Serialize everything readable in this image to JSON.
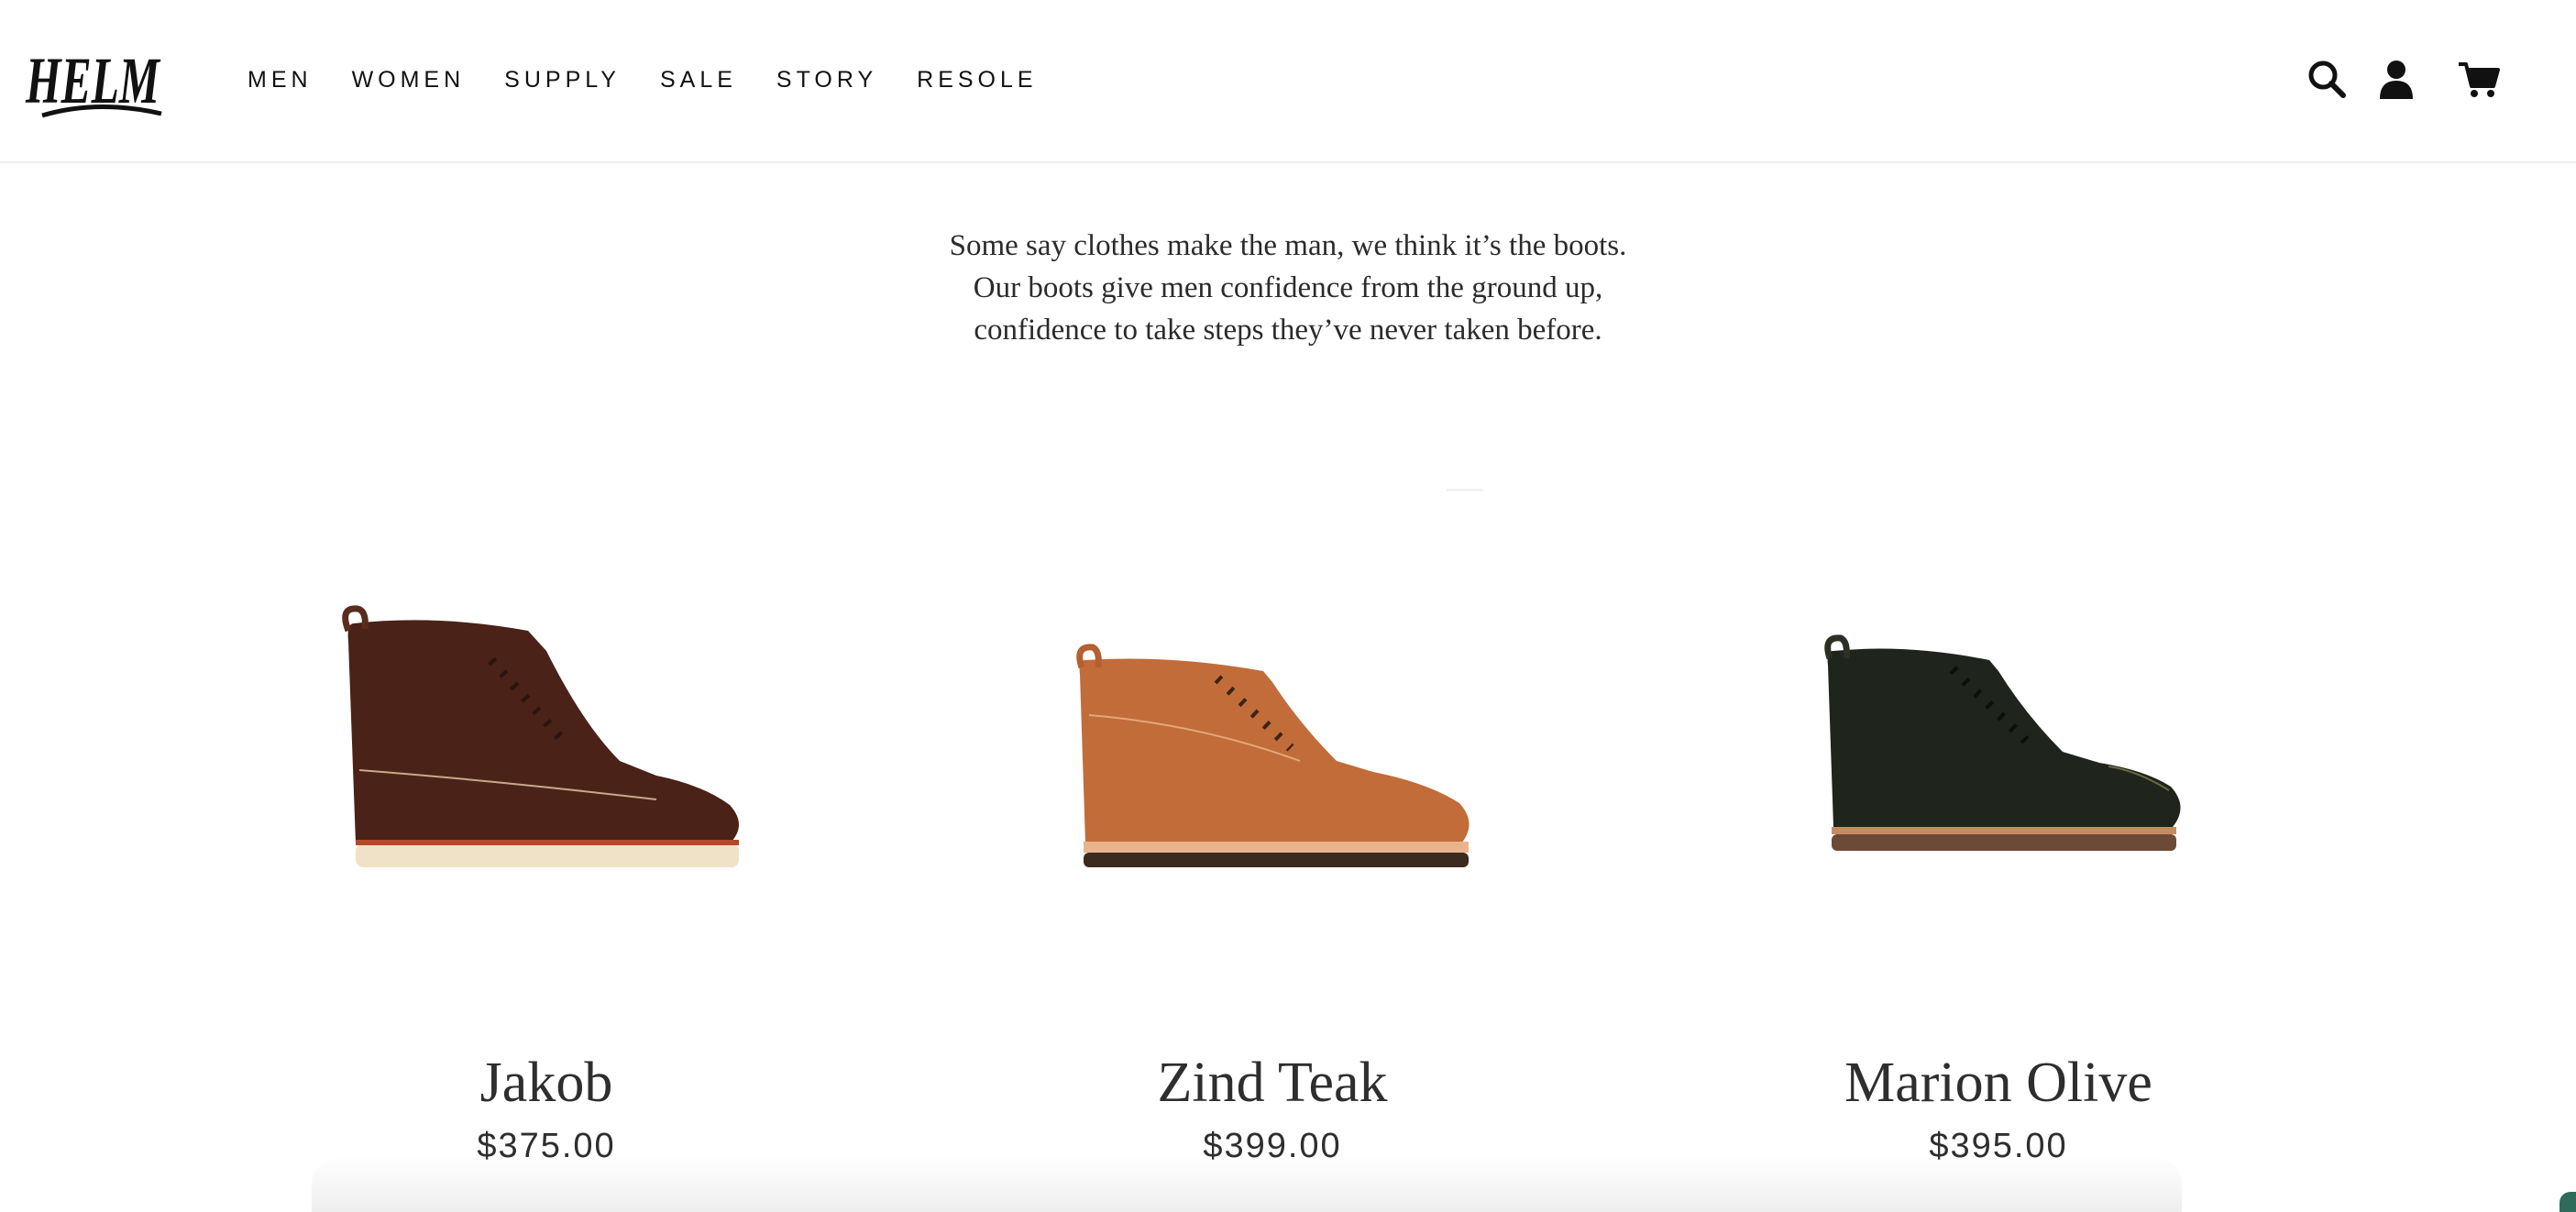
{
  "brand": {
    "logo_text": "HELM"
  },
  "nav": {
    "items": [
      {
        "label": "MEN"
      },
      {
        "label": "WOMEN"
      },
      {
        "label": "SUPPLY"
      },
      {
        "label": "SALE"
      },
      {
        "label": "STORY"
      },
      {
        "label": "RESOLE"
      }
    ]
  },
  "header_icons": [
    "search-icon",
    "account-icon",
    "cart-icon"
  ],
  "intro": {
    "lines": [
      "Some say clothes make the man, we think it’s the boots.",
      "Our boots give men confidence from the ground up,",
      "confidence to take steps they’ve never taken before."
    ]
  },
  "products": [
    {
      "name": "Jakob",
      "price": "$375.00",
      "color": "#4a2218",
      "sole": "#efe2c6"
    },
    {
      "name": "Zind Teak",
      "price": "$399.00",
      "color": "#c26c3a",
      "sole": "#3b2a1e"
    },
    {
      "name": "Marion Olive",
      "price": "$395.00",
      "color": "#1f241c",
      "sole": "#6d4a35"
    }
  ]
}
